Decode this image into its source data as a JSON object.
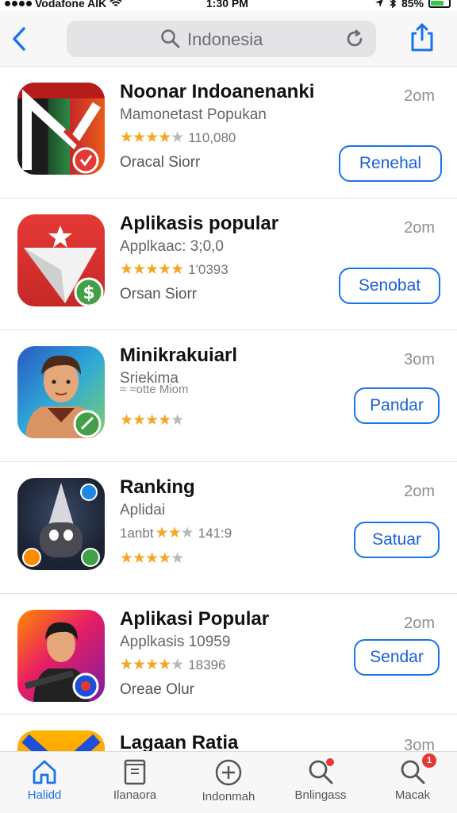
{
  "status_bar": {
    "carrier": "Vodafone AIK",
    "time": "1:30 PM",
    "battery": "85%"
  },
  "nav": {
    "search_text": "Indonesia"
  },
  "apps": [
    {
      "title": "Noonar Indoanenanki",
      "subtitle": "Mamonetast Popukan",
      "stars": 4,
      "rating_count": "110,080",
      "seller": "Oracal Siorr",
      "age": "2om",
      "button": "Renehal"
    },
    {
      "title": "Aplikasis popular",
      "subtitle": "Applkaac: 3;0,0",
      "stars": 5,
      "rating_count": "1'0393",
      "seller": "Orsan Siorr",
      "age": "2om",
      "button": "Senobat"
    },
    {
      "title": "Minikrakuiarl",
      "subtitle": "Sriekima",
      "subtitle2": "≈ ≈otte Miom",
      "stars": 4,
      "rating_count": "",
      "seller": "",
      "age": "3om",
      "button": "Pandar"
    },
    {
      "title": "Ranking",
      "subtitle": "Aplidai",
      "stars_line_prefix": "1anbt",
      "stars_line_count": "141:9",
      "stars": 4,
      "rating_count": "",
      "seller": "",
      "age": "2om",
      "button": "Satuar"
    },
    {
      "title": "Aplikasi Popular",
      "subtitle": "Applkasis 10959",
      "stars": 4,
      "rating_count": "18396",
      "seller": "Oreae Olur",
      "age": "2om",
      "button": "Sendar"
    },
    {
      "title": "Lagaan Ratia",
      "age": "3om"
    }
  ],
  "tabbar": {
    "tabs": [
      {
        "label": "Halidd",
        "icon": "home-icon",
        "active": true
      },
      {
        "label": "Ilanaora",
        "icon": "book-icon"
      },
      {
        "label": "Indonmah",
        "icon": "plus-circle-icon"
      },
      {
        "label": "Bnlingass",
        "icon": "search-icon",
        "badge": ""
      },
      {
        "label": "Macak",
        "icon": "search-icon",
        "badge": "1"
      }
    ]
  },
  "colors": {
    "accent": "#1a73e8",
    "star": "#f5a623"
  }
}
